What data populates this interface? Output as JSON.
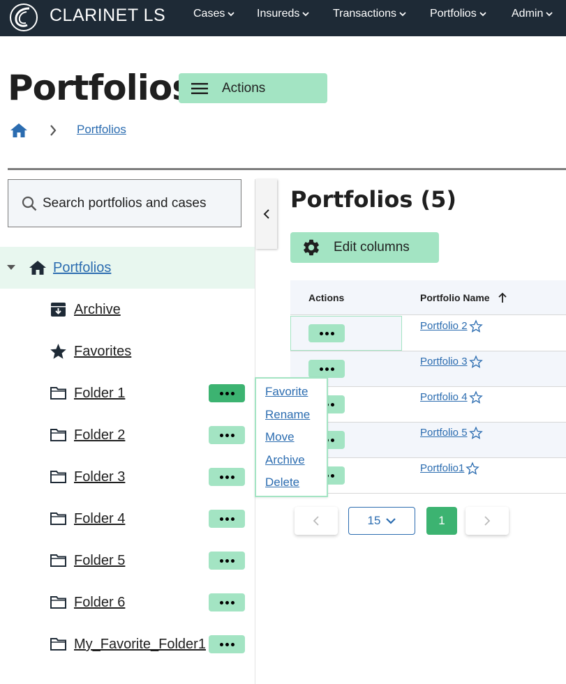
{
  "app": {
    "brand": "CLARINET LS",
    "logo_icon": "clarinet-logo-icon"
  },
  "nav": {
    "items": [
      {
        "label": "Cases"
      },
      {
        "label": "Insureds"
      },
      {
        "label": "Transactions"
      },
      {
        "label": "Portfolios"
      },
      {
        "label": "Admin"
      }
    ]
  },
  "header": {
    "title": "Portfolios",
    "actions_label": "Actions"
  },
  "breadcrumb": {
    "current": "Portfolios"
  },
  "sidebar": {
    "search_placeholder": "Search portfolios and cases",
    "root": {
      "label": "Portfolios"
    },
    "items": [
      {
        "label": "Archive",
        "icon": "archive-icon"
      },
      {
        "label": "Favorites",
        "icon": "star-icon"
      },
      {
        "label": "Folder 1",
        "icon": "folder-icon",
        "menu": true
      },
      {
        "label": "Folder 2",
        "icon": "folder-icon",
        "menu": true
      },
      {
        "label": "Folder 3",
        "icon": "folder-icon",
        "menu": true
      },
      {
        "label": "Folder 4",
        "icon": "folder-icon",
        "menu": true
      },
      {
        "label": "Folder 5",
        "icon": "folder-icon",
        "menu": true
      },
      {
        "label": "Folder 6",
        "icon": "folder-icon",
        "menu": true
      },
      {
        "label": "My_Favorite_Folder1",
        "icon": "folder-icon",
        "menu": true
      }
    ]
  },
  "context_menu": {
    "items": [
      "Favorite",
      "Rename",
      "Move",
      "Archive",
      "Delete"
    ]
  },
  "main": {
    "title": "Portfolios (5)",
    "edit_columns_label": "Edit columns",
    "table": {
      "columns": [
        "Actions",
        "Portfolio Name"
      ],
      "sort_column": "Portfolio Name",
      "rows": [
        {
          "name": "Portfolio 2 "
        },
        {
          "name": "Portfolio 3 "
        },
        {
          "name": "Portfolio 4 "
        },
        {
          "name": "Portfolio 5 "
        },
        {
          "name": "Portfolio1 "
        }
      ]
    },
    "pagination": {
      "page_size": "15",
      "current_page": "1"
    }
  },
  "colors": {
    "nav_bg": "#1e2a36",
    "accent_light": "#a3e4c3",
    "accent": "#3cb371",
    "link": "#2b6cb0",
    "selected_bg": "#e8f7ef"
  }
}
